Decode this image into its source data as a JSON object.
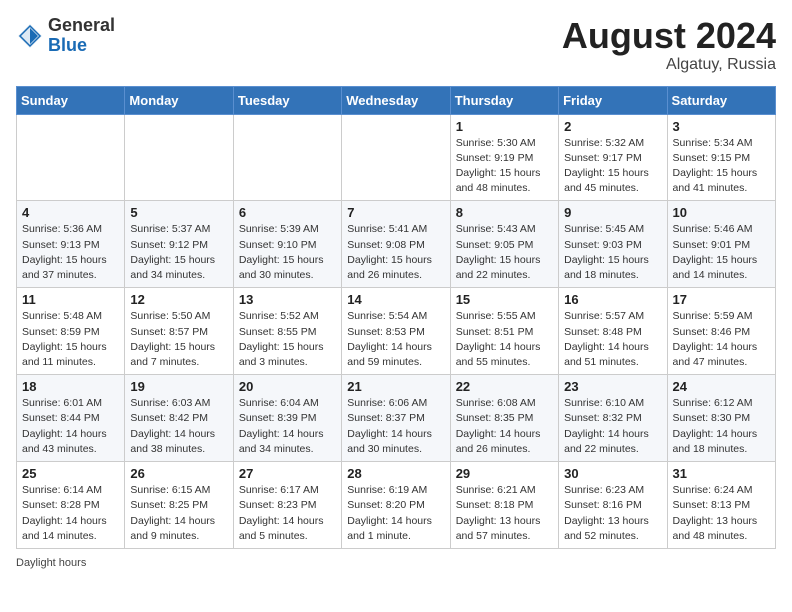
{
  "header": {
    "logo_general": "General",
    "logo_blue": "Blue",
    "month_year": "August 2024",
    "location": "Algatuy, Russia"
  },
  "footer": {
    "daylight_hours": "Daylight hours"
  },
  "weekdays": [
    "Sunday",
    "Monday",
    "Tuesday",
    "Wednesday",
    "Thursday",
    "Friday",
    "Saturday"
  ],
  "weeks": [
    [
      {
        "day": "",
        "info": ""
      },
      {
        "day": "",
        "info": ""
      },
      {
        "day": "",
        "info": ""
      },
      {
        "day": "",
        "info": ""
      },
      {
        "day": "1",
        "info": "Sunrise: 5:30 AM\nSunset: 9:19 PM\nDaylight: 15 hours\nand 48 minutes."
      },
      {
        "day": "2",
        "info": "Sunrise: 5:32 AM\nSunset: 9:17 PM\nDaylight: 15 hours\nand 45 minutes."
      },
      {
        "day": "3",
        "info": "Sunrise: 5:34 AM\nSunset: 9:15 PM\nDaylight: 15 hours\nand 41 minutes."
      }
    ],
    [
      {
        "day": "4",
        "info": "Sunrise: 5:36 AM\nSunset: 9:13 PM\nDaylight: 15 hours\nand 37 minutes."
      },
      {
        "day": "5",
        "info": "Sunrise: 5:37 AM\nSunset: 9:12 PM\nDaylight: 15 hours\nand 34 minutes."
      },
      {
        "day": "6",
        "info": "Sunrise: 5:39 AM\nSunset: 9:10 PM\nDaylight: 15 hours\nand 30 minutes."
      },
      {
        "day": "7",
        "info": "Sunrise: 5:41 AM\nSunset: 9:08 PM\nDaylight: 15 hours\nand 26 minutes."
      },
      {
        "day": "8",
        "info": "Sunrise: 5:43 AM\nSunset: 9:05 PM\nDaylight: 15 hours\nand 22 minutes."
      },
      {
        "day": "9",
        "info": "Sunrise: 5:45 AM\nSunset: 9:03 PM\nDaylight: 15 hours\nand 18 minutes."
      },
      {
        "day": "10",
        "info": "Sunrise: 5:46 AM\nSunset: 9:01 PM\nDaylight: 15 hours\nand 14 minutes."
      }
    ],
    [
      {
        "day": "11",
        "info": "Sunrise: 5:48 AM\nSunset: 8:59 PM\nDaylight: 15 hours\nand 11 minutes."
      },
      {
        "day": "12",
        "info": "Sunrise: 5:50 AM\nSunset: 8:57 PM\nDaylight: 15 hours\nand 7 minutes."
      },
      {
        "day": "13",
        "info": "Sunrise: 5:52 AM\nSunset: 8:55 PM\nDaylight: 15 hours\nand 3 minutes."
      },
      {
        "day": "14",
        "info": "Sunrise: 5:54 AM\nSunset: 8:53 PM\nDaylight: 14 hours\nand 59 minutes."
      },
      {
        "day": "15",
        "info": "Sunrise: 5:55 AM\nSunset: 8:51 PM\nDaylight: 14 hours\nand 55 minutes."
      },
      {
        "day": "16",
        "info": "Sunrise: 5:57 AM\nSunset: 8:48 PM\nDaylight: 14 hours\nand 51 minutes."
      },
      {
        "day": "17",
        "info": "Sunrise: 5:59 AM\nSunset: 8:46 PM\nDaylight: 14 hours\nand 47 minutes."
      }
    ],
    [
      {
        "day": "18",
        "info": "Sunrise: 6:01 AM\nSunset: 8:44 PM\nDaylight: 14 hours\nand 43 minutes."
      },
      {
        "day": "19",
        "info": "Sunrise: 6:03 AM\nSunset: 8:42 PM\nDaylight: 14 hours\nand 38 minutes."
      },
      {
        "day": "20",
        "info": "Sunrise: 6:04 AM\nSunset: 8:39 PM\nDaylight: 14 hours\nand 34 minutes."
      },
      {
        "day": "21",
        "info": "Sunrise: 6:06 AM\nSunset: 8:37 PM\nDaylight: 14 hours\nand 30 minutes."
      },
      {
        "day": "22",
        "info": "Sunrise: 6:08 AM\nSunset: 8:35 PM\nDaylight: 14 hours\nand 26 minutes."
      },
      {
        "day": "23",
        "info": "Sunrise: 6:10 AM\nSunset: 8:32 PM\nDaylight: 14 hours\nand 22 minutes."
      },
      {
        "day": "24",
        "info": "Sunrise: 6:12 AM\nSunset: 8:30 PM\nDaylight: 14 hours\nand 18 minutes."
      }
    ],
    [
      {
        "day": "25",
        "info": "Sunrise: 6:14 AM\nSunset: 8:28 PM\nDaylight: 14 hours\nand 14 minutes."
      },
      {
        "day": "26",
        "info": "Sunrise: 6:15 AM\nSunset: 8:25 PM\nDaylight: 14 hours\nand 9 minutes."
      },
      {
        "day": "27",
        "info": "Sunrise: 6:17 AM\nSunset: 8:23 PM\nDaylight: 14 hours\nand 5 minutes."
      },
      {
        "day": "28",
        "info": "Sunrise: 6:19 AM\nSunset: 8:20 PM\nDaylight: 14 hours\nand 1 minute."
      },
      {
        "day": "29",
        "info": "Sunrise: 6:21 AM\nSunset: 8:18 PM\nDaylight: 13 hours\nand 57 minutes."
      },
      {
        "day": "30",
        "info": "Sunrise: 6:23 AM\nSunset: 8:16 PM\nDaylight: 13 hours\nand 52 minutes."
      },
      {
        "day": "31",
        "info": "Sunrise: 6:24 AM\nSunset: 8:13 PM\nDaylight: 13 hours\nand 48 minutes."
      }
    ]
  ]
}
